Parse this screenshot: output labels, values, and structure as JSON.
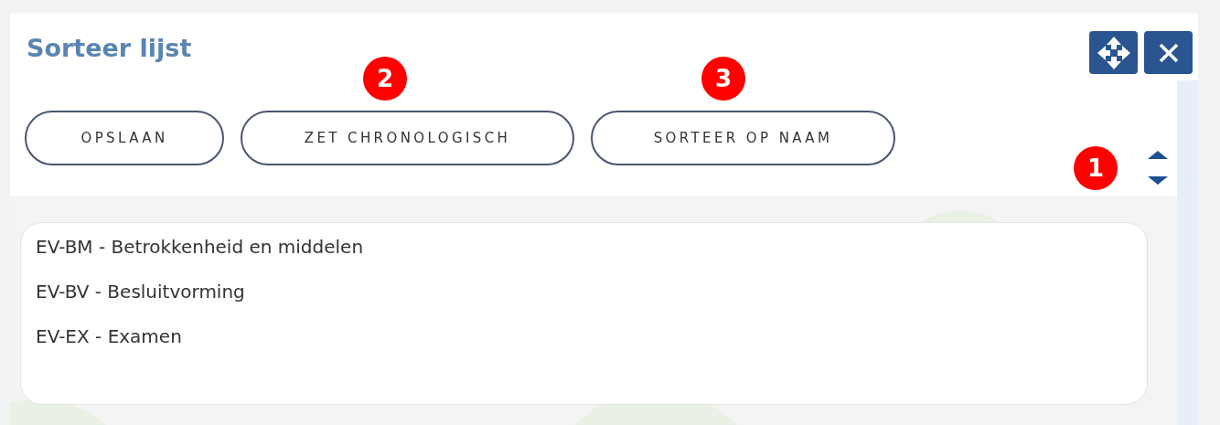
{
  "dialog": {
    "title": "Sorteer lijst"
  },
  "buttons": [
    {
      "label": "OPSLAAN"
    },
    {
      "label": "ZET CHRONOLOGISCH",
      "callout": "2"
    },
    {
      "label": "SORTEER OP NAAM",
      "callout": "3"
    }
  ],
  "sort_control": {
    "callout": "1"
  },
  "list_items": [
    "EV-BM - Betrokkenheid en middelen",
    "EV-BV - Besluitvorming",
    "EV-EX - Examen"
  ]
}
